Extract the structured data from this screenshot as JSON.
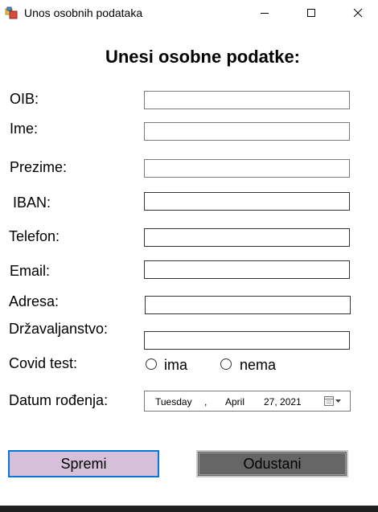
{
  "window": {
    "title": "Unos osobnih podataka",
    "icons": {
      "app": "form-app-icon",
      "minimize": "minimize-icon",
      "maximize": "maximize-icon",
      "close": "close-icon"
    }
  },
  "form": {
    "heading": "Unesi osobne podatke:",
    "labels": {
      "oib": "OIB:",
      "ime": "Ime:",
      "prezime": "Prezime:",
      "iban": "IBAN:",
      "telefon": "Telefon:",
      "email": "Email:",
      "adresa": "Adresa:",
      "drzavljanstvo": "Državaljanstvo:",
      "covid": "Covid test:",
      "datum": "Datum rođenja:"
    },
    "fields": {
      "oib": "",
      "ime": "",
      "prezime": "",
      "iban": "",
      "telefon": "",
      "email": "",
      "adresa": "",
      "drzavljanstvo": ""
    },
    "covid_options": {
      "yes": "ima",
      "no": "nema",
      "selected": ""
    },
    "date_picker": {
      "weekday": "Tuesday",
      "separator": ",",
      "month": "April",
      "day_year": "27, 2021",
      "icon": "calendar-dropdown-icon"
    },
    "buttons": {
      "save": "Spremi",
      "cancel": "Odustani"
    }
  },
  "colors": {
    "save_button_bg": "#d6c0d9",
    "save_button_border": "#0078d7",
    "cancel_button_bg": "#666666"
  }
}
